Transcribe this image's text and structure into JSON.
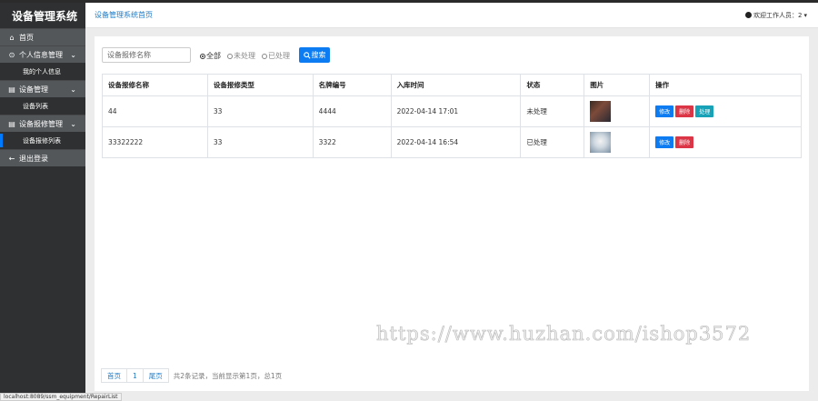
{
  "sidebar": {
    "brand": "设备管理系统",
    "home": "首页",
    "groups": [
      {
        "label": "个人信息管理",
        "items": [
          "我的个人信息"
        ]
      },
      {
        "label": "设备管理",
        "items": [
          "设备列表"
        ]
      },
      {
        "label": "设备报修管理",
        "items": [
          "设备报修列表"
        ]
      }
    ],
    "logout": "退出登录"
  },
  "header": {
    "breadcrumb": "设备管理系统首页",
    "welcome": "欢迎工作人员：2",
    "caret": "▾"
  },
  "search": {
    "placeholder": "设备报修名称",
    "radios": [
      "全部",
      "未处理",
      "已处理"
    ],
    "selected": "全部",
    "button_label": "搜索",
    "button_icon": "search-icon"
  },
  "table": {
    "headers": [
      "设备报修名称",
      "设备报修类型",
      "名牌编号",
      "入库时间",
      "状态",
      "图片",
      "操作"
    ],
    "rows": [
      {
        "name": "44",
        "type": "33",
        "code": "4444",
        "time": "2022-04-14 17:01",
        "status": "未处理",
        "actions": [
          "修改",
          "删除",
          "处理"
        ]
      },
      {
        "name": "33322222",
        "type": "33",
        "code": "3322",
        "time": "2022-04-14 16:54",
        "status": "已处理",
        "actions": [
          "修改",
          "删除"
        ]
      }
    ]
  },
  "pagination": {
    "first": "首页",
    "page": "1",
    "last": "尾页",
    "info": "共2条记录，当前显示第1页，总1页"
  },
  "watermark": "https://www.huzhan.com/ishop3572",
  "status_url": "localhost:8089/ssm_equipment/RepairList",
  "colors": {
    "sidebar": "#2f3031",
    "sidebar_group": "#53575a",
    "primary": "#0d7cf2",
    "danger": "#dc3545",
    "info": "#17a2b8",
    "link": "#1e7cc7"
  }
}
